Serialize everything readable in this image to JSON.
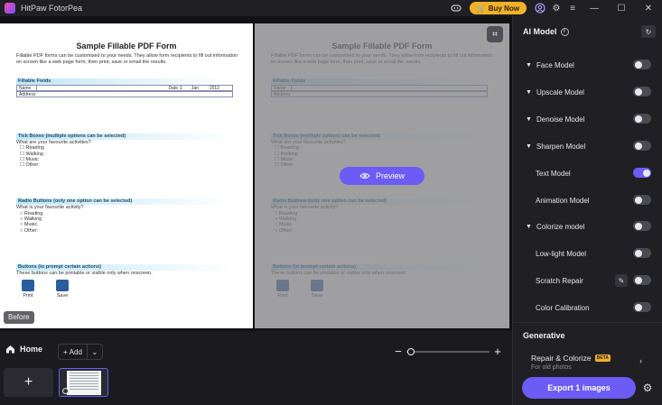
{
  "app": {
    "title": "HitPaw FotorPea",
    "buy_label": "Buy Now"
  },
  "document": {
    "title": "Sample Fillable PDF Form",
    "intro": "Fillable PDF forms can be customised to your needs. They allow form recipients to fill out information on screen like a web page form, then print, save or email the results.",
    "fillable_header": "Fillable Fields",
    "name_label": "Name",
    "date_label": "Date",
    "date_day": "1",
    "date_month": "Jan",
    "date_year": "2012",
    "address_label": "Address",
    "tick_header": "Tick Boxes (multiple options can be selected)",
    "tick_question": "What are your favourite activities?",
    "tick_options": [
      "Reading",
      "Walking",
      "Music",
      "Other:"
    ],
    "radio_header": "Radio Buttons (only one option can be selected)",
    "radio_question": "What is your favourite activity?",
    "radio_options": [
      "Reading",
      "Walking",
      "Music",
      "Other:"
    ],
    "buttons_header": "Buttons (to prompt certain actions)",
    "buttons_text": "These buttons can be printable or visible only when onscreen.",
    "print_label": "Print",
    "save_label": "Save"
  },
  "canvas": {
    "before_label": "Before",
    "preview_label": "Preview"
  },
  "bottom": {
    "home_label": "Home",
    "add_label": "Add",
    "zoom_level": 0.05
  },
  "panel": {
    "title": "AI Model",
    "models": [
      {
        "label": "Face Model",
        "expandable": true,
        "on": false
      },
      {
        "label": "Upscale Model",
        "expandable": true,
        "on": false
      },
      {
        "label": "Denoise Model",
        "expandable": true,
        "on": false
      },
      {
        "label": "Sharpen Model",
        "expandable": true,
        "on": false
      },
      {
        "label": "Text Model",
        "expandable": false,
        "on": true
      },
      {
        "label": "Animation Model",
        "expandable": false,
        "on": false
      },
      {
        "label": "Colorize model",
        "expandable": true,
        "on": false
      },
      {
        "label": "Low-light Model",
        "expandable": false,
        "on": false
      },
      {
        "label": "Scratch Repair",
        "expandable": false,
        "on": false
      },
      {
        "label": "Color Calibration",
        "expandable": false,
        "on": false
      }
    ],
    "generative_title": "Generative",
    "generative_item": "Repair & Colorize",
    "generative_badge": "BETA",
    "generative_sub": "For old photos",
    "export_label": "Export 1 images"
  },
  "colors": {
    "accent": "#6b5cf6",
    "buy": "#f3b12a"
  }
}
